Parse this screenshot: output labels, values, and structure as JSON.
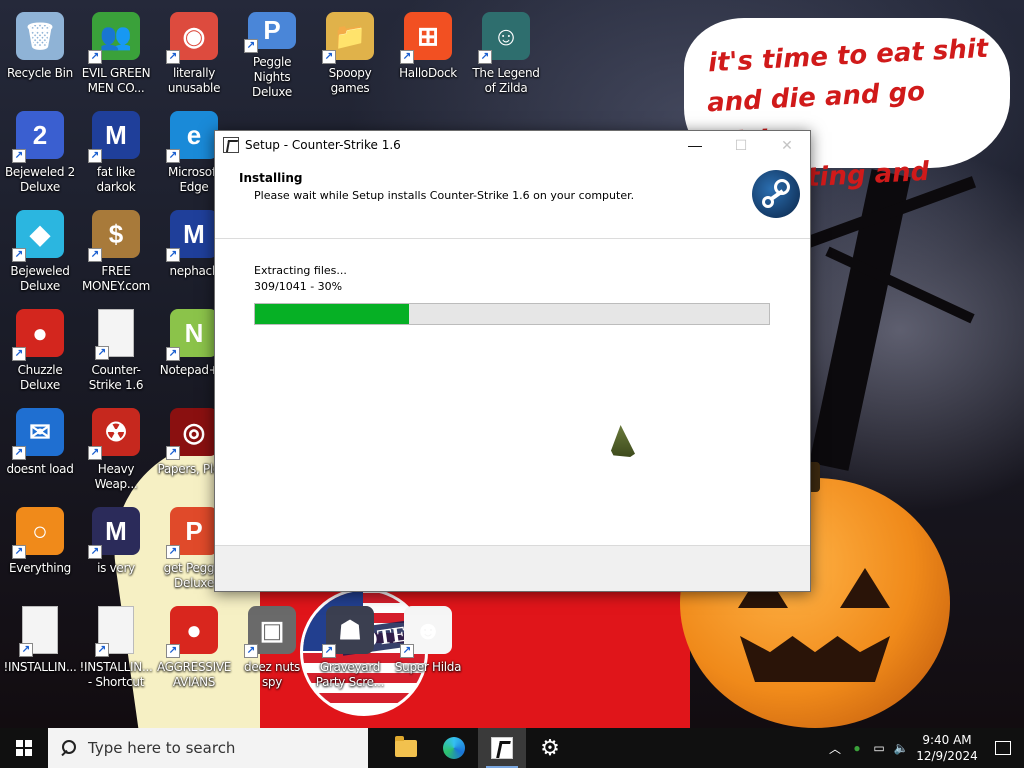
{
  "wallpaper": {
    "bubble_lines": [
      "it's time to eat shit",
      "and die and go trick",
      "or treating and vote!"
    ],
    "badge_text": "VOTE"
  },
  "desktop_icons": [
    {
      "label": "Recycle Bin",
      "icon": "recycle-bin-icon",
      "color": "#8fb3d6",
      "glyph": "🗑"
    },
    {
      "label": "EVIL GREEN MEN CO...",
      "icon": "green-men-icon",
      "color": "#3aa13a",
      "glyph": "👥"
    },
    {
      "label": "literally unusable",
      "icon": "chrome-icon",
      "color": "#dd4b3e",
      "glyph": "◉"
    },
    {
      "label": "Peggle Nights Deluxe",
      "icon": "peggle-icon",
      "color": "#4a86d8",
      "glyph": "P"
    },
    {
      "label": "Spoopy games",
      "icon": "folder-icon",
      "color": "#e0b24a",
      "glyph": "📁"
    },
    {
      "label": "HalloDock",
      "icon": "windows-logo-icon",
      "color": "#f25022",
      "glyph": "⊞"
    },
    {
      "label": "The Legend of Zilda",
      "icon": "zilda-icon",
      "color": "#2e6e6e",
      "glyph": "☺"
    },
    {
      "label": "Bejeweled 2 Deluxe",
      "icon": "bejeweled-2-icon",
      "color": "#3a5fd0",
      "glyph": "2"
    },
    {
      "label": "fat like darkok",
      "icon": "mpl-icon",
      "color": "#1f3f9a",
      "glyph": "M"
    },
    {
      "label": "Microsoft Edge",
      "icon": "edge-icon",
      "color": "#1a8ad8",
      "glyph": "e"
    },
    {
      "label": "Bejeweled Deluxe",
      "icon": "bejeweled-icon",
      "color": "#2bb6e0",
      "glyph": "◆"
    },
    {
      "label": "FREE MONEY.com",
      "icon": "money-bag-icon",
      "color": "#a87a3a",
      "glyph": "$"
    },
    {
      "label": "nephack",
      "icon": "mpl-icon",
      "color": "#1f3f9a",
      "glyph": "M"
    },
    {
      "label": "Chuzzle Deluxe",
      "icon": "chuzzle-icon",
      "color": "#d3261e",
      "glyph": "●"
    },
    {
      "label": "Counter-Strike 1.6",
      "icon": "document-icon",
      "color": "#f4f4f4",
      "glyph": ""
    },
    {
      "label": "Notepad++",
      "icon": "notepad-plus-plus-icon",
      "color": "#8bc34a",
      "glyph": "N"
    },
    {
      "label": "doesnt load",
      "icon": "thunderbird-icon",
      "color": "#1f6fd1",
      "glyph": "✉"
    },
    {
      "label": "Heavy Weap...",
      "icon": "radiation-icon",
      "color": "#c6281e",
      "glyph": "☢"
    },
    {
      "label": "Papers, Ple...",
      "icon": "papers-please-icon",
      "color": "#8a1010",
      "glyph": "◎"
    },
    {
      "label": "Everything",
      "icon": "search-ring-icon",
      "color": "#f08a1a",
      "glyph": "○"
    },
    {
      "label": "is very",
      "icon": "mpl-shield-icon",
      "color": "#2b2b5a",
      "glyph": "M"
    },
    {
      "label": "get Peggle Deluxe",
      "icon": "peggle-icon",
      "color": "#e04a2a",
      "glyph": "P"
    },
    {
      "label": "!INSTALLIN...",
      "icon": "document-icon",
      "color": "#f4f4f4",
      "glyph": ""
    },
    {
      "label": "!INSTALLIN... - Shortcut",
      "icon": "document-icon",
      "color": "#f4f4f4",
      "glyph": ""
    },
    {
      "label": "AGGRESSIVE AVIANS",
      "icon": "angry-bird-icon",
      "color": "#d9261e",
      "glyph": "●"
    },
    {
      "label": "deez nuts spy",
      "icon": "windows-stack-icon",
      "color": "#6a6a6a",
      "glyph": "▣"
    },
    {
      "label": "Graveyard Party Scre...",
      "icon": "graveyard-icon",
      "color": "#3b3f50",
      "glyph": "☗"
    },
    {
      "label": "Super Hilda",
      "icon": "hilda-icon",
      "color": "#f6f6f6",
      "glyph": "☻"
    }
  ],
  "setup": {
    "title": "Setup - Counter-Strike 1.6",
    "heading": "Installing",
    "subheading": "Please wait while Setup installs Counter-Strike 1.6 on your computer.",
    "status": "Extracting files...",
    "progress_text": "309/1041 - 30%",
    "progress_fraction": 0.3,
    "minimize": "—",
    "maximize": "☐",
    "close": "✕"
  },
  "taskbar": {
    "search_placeholder": "Type here to search",
    "apps": [
      "file-explorer",
      "microsoft-edge",
      "counter-strike-setup",
      "settings"
    ],
    "clock_time": "9:40 AM",
    "clock_date": "12/9/2024"
  }
}
